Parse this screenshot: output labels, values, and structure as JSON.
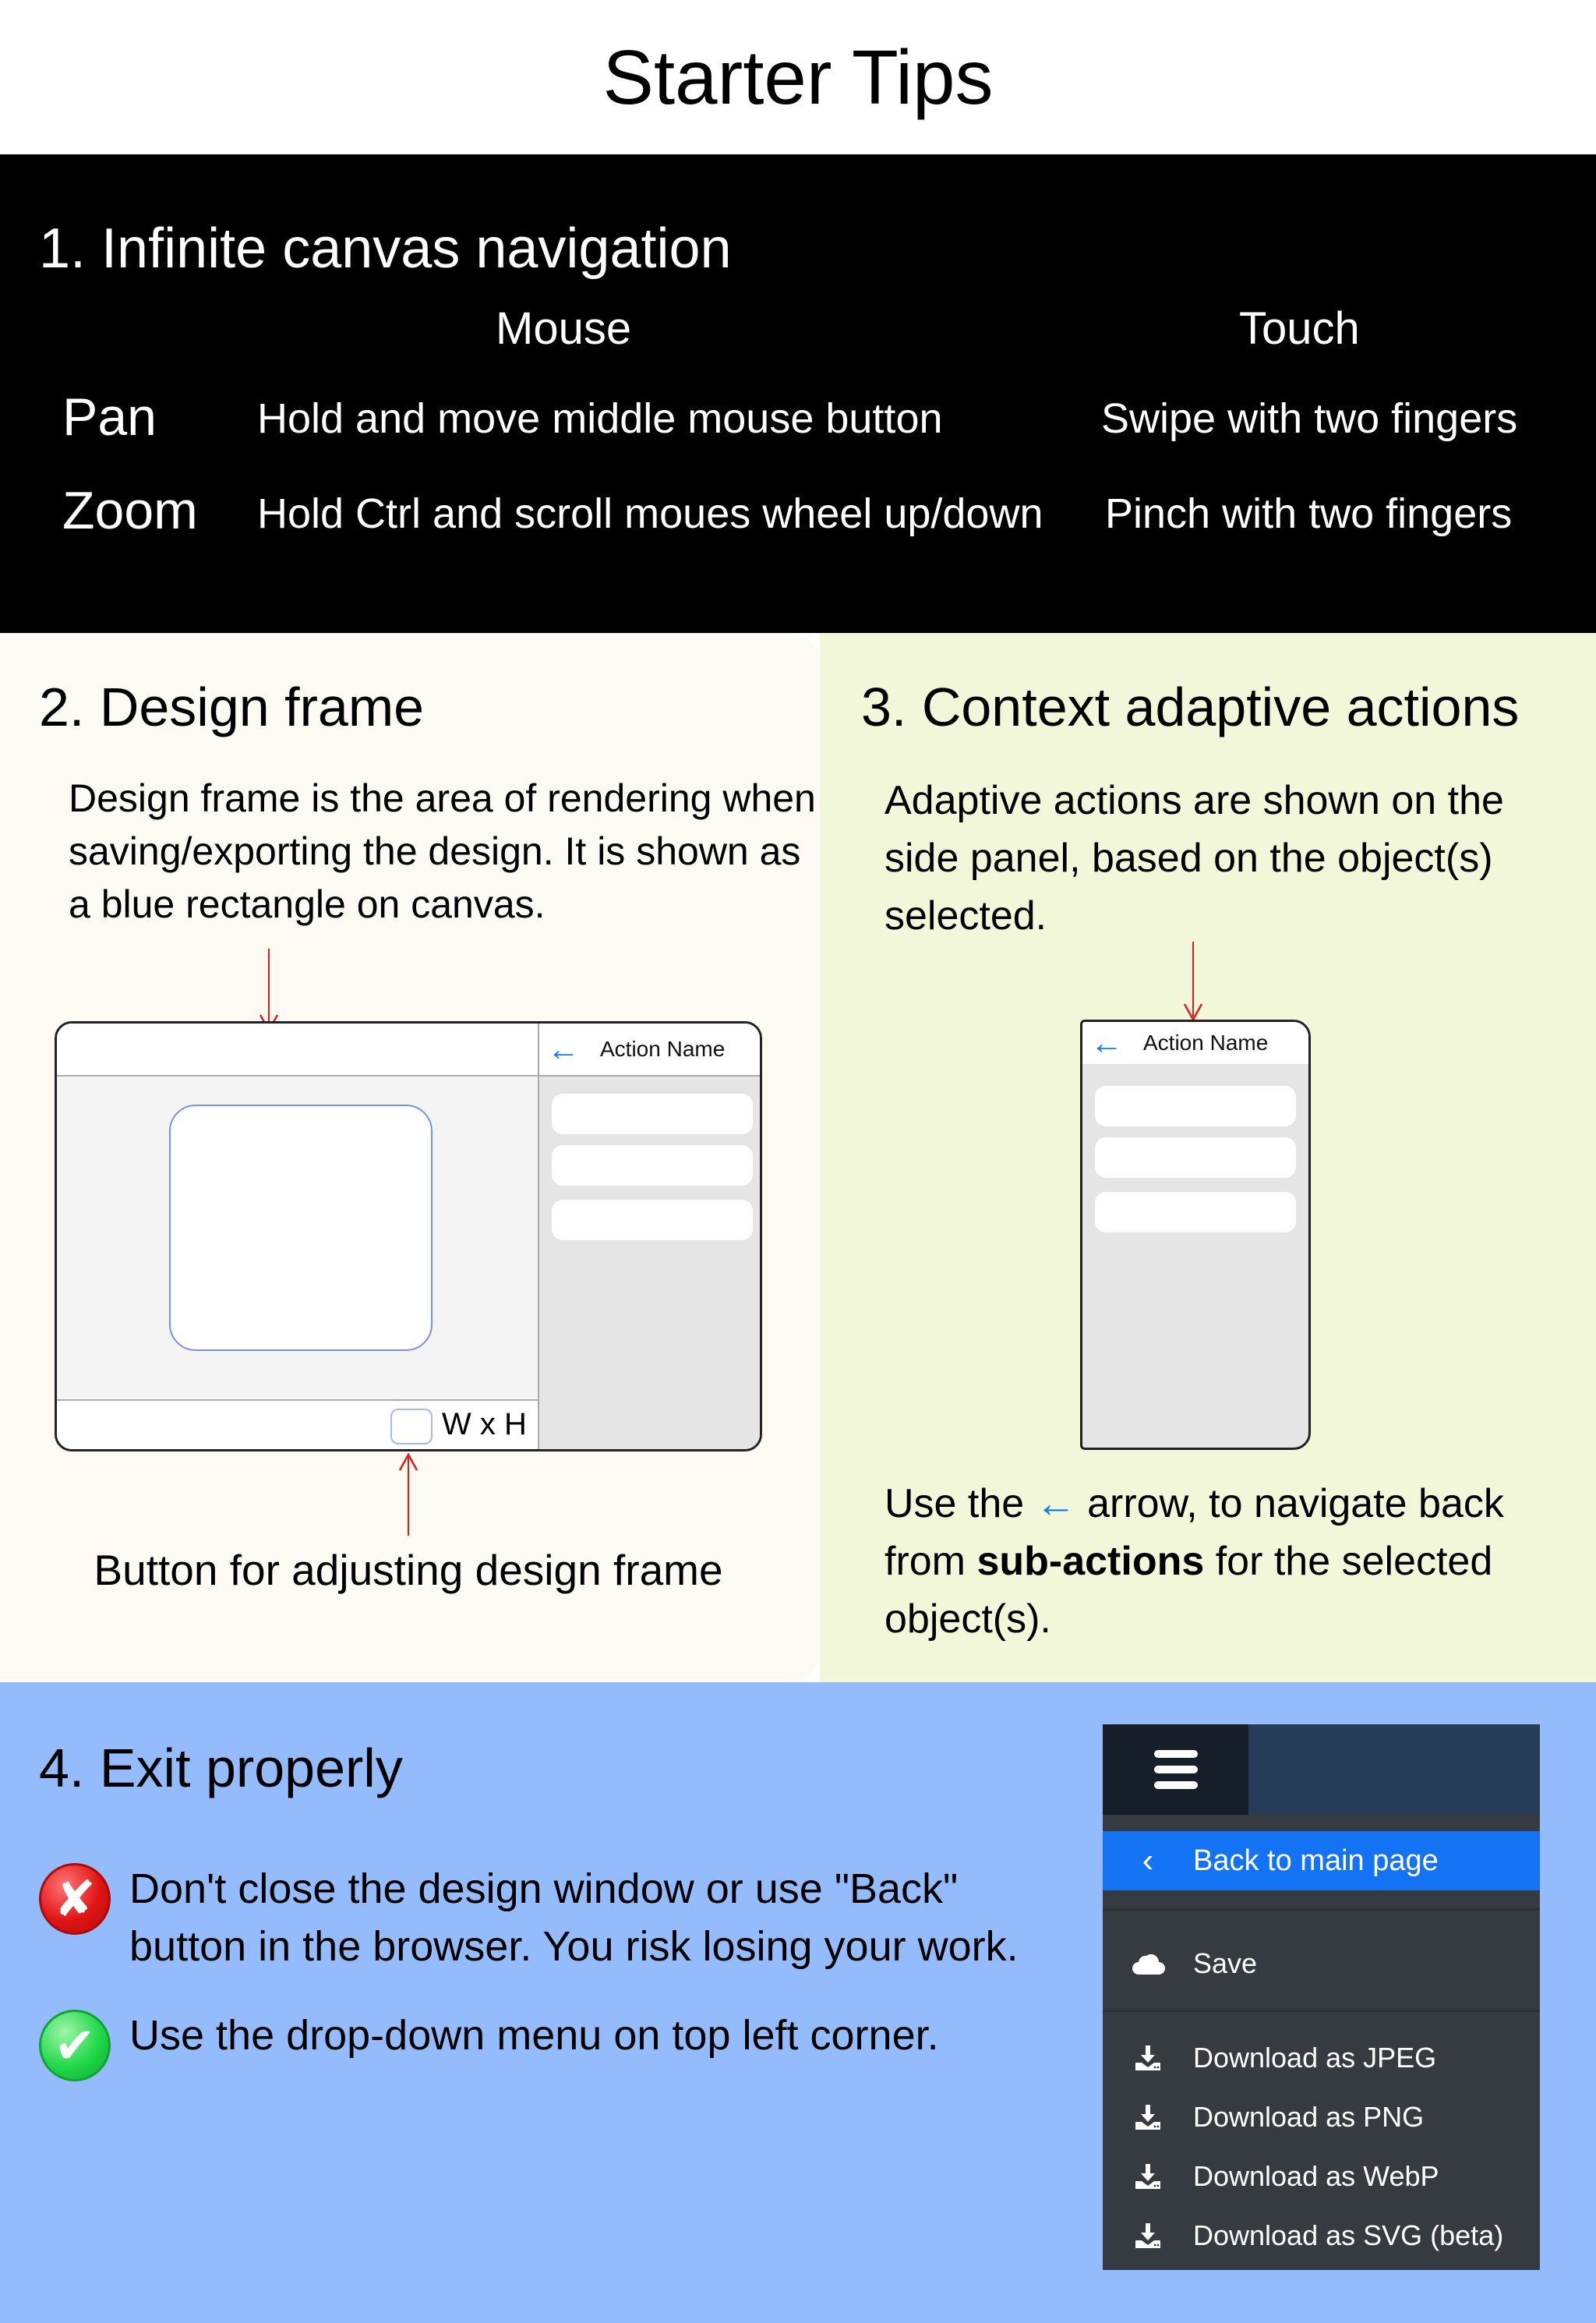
{
  "title": "Starter Tips",
  "section1": {
    "heading": "1. Infinite canvas navigation",
    "columns": [
      "Mouse",
      "Touch"
    ],
    "rows": [
      {
        "label": "Pan",
        "mouse": "Hold and move middle mouse button",
        "touch": "Swipe with two fingers"
      },
      {
        "label": "Zoom",
        "mouse": "Hold Ctrl and scroll moues wheel up/down",
        "touch": "Pinch with two fingers"
      }
    ]
  },
  "section2": {
    "heading": "2. Design frame",
    "description": "Design frame is the area of rendering when saving/exporting the design. It is shown as a blue rectangle on canvas.",
    "mockup": {
      "panel_title": "Action Name",
      "size_label": "W x H"
    },
    "caption": "Button for adjusting design frame"
  },
  "section3": {
    "heading": "3. Context adaptive actions",
    "description": "Adaptive actions are shown on the side panel, based on the object(s) selected.",
    "mockup": {
      "panel_title": "Action Name"
    },
    "note": {
      "prefix": "Use the",
      "arrow": "←",
      "middle": "arrow, to navigate back from",
      "bold": "sub-actions",
      "suffix": " for the selected object(s)."
    }
  },
  "section4": {
    "heading": "4. Exit properly",
    "items": [
      {
        "status": "bad",
        "icon": "✘",
        "text": "Don't close the design window or use \"Back\" button in the browser. You risk losing your work."
      },
      {
        "status": "good",
        "icon": "✔",
        "text": "Use the drop-down menu on top left corner."
      }
    ],
    "menu": {
      "back_label": "Back to main page",
      "save_label": "Save",
      "downloads": [
        "Download as JPEG",
        "Download as PNG",
        "Download as WebP",
        "Download as SVG (beta)"
      ]
    }
  },
  "colors": {
    "section1_bg": "#000000",
    "section2_bg": "#fdf9f3",
    "section3_bg": "#f2f7d9",
    "section4_bg": "#94bcfc",
    "accent_blue": "#1473f5",
    "annotation_red": "#e21b1b",
    "frame_blue": "#7b8ff0"
  }
}
